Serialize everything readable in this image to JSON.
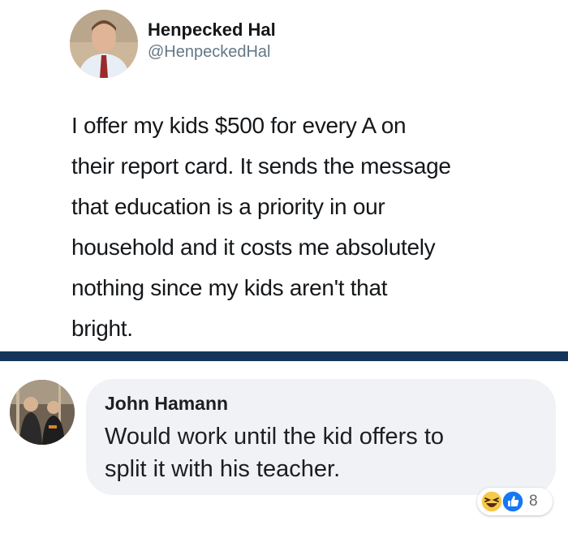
{
  "tweet": {
    "author_name": "Henpecked Hal",
    "author_handle": "@HenpeckedHal",
    "text_lines": [
      "I offer my kids $500 for every A on",
      "their report card. It sends the message",
      "that education is a priority in our",
      "household and it costs me absolutely",
      "nothing since my kids aren't that",
      "bright."
    ]
  },
  "comment": {
    "author_name": "John Hamann",
    "text_lines": [
      "Would work until the kid offers to",
      "split it with his teacher."
    ],
    "reactions": {
      "icons": [
        "haha-reaction-icon",
        "like-reaction-icon"
      ],
      "count": "8"
    }
  },
  "colors": {
    "divider": "#15365a",
    "bubble": "#f0f2f5",
    "like_blue": "#1877f2",
    "haha_yellow": "#f7c948"
  }
}
